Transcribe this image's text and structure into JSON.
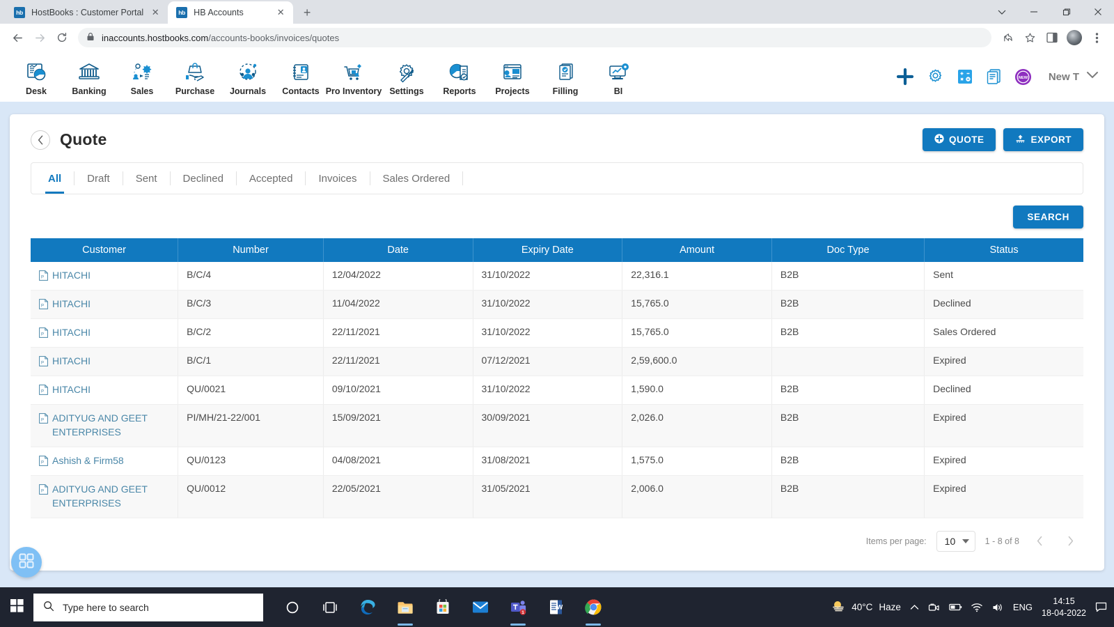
{
  "browser": {
    "tabs": [
      {
        "title": "HostBooks : Customer Portal",
        "favicon": "hb",
        "active": false
      },
      {
        "title": "HB Accounts",
        "favicon": "hb",
        "active": true
      }
    ],
    "new_tab_label": "+",
    "url_domain": "inaccounts.hostbooks.com",
    "url_path": "/accounts-books/invoices/quotes",
    "window_controls": {
      "minimize": "−",
      "maximize": "❐",
      "close": "✕",
      "tab_search": "⌄"
    }
  },
  "appnav": {
    "items": [
      {
        "label": "Desk",
        "icon": "dashboard-icon"
      },
      {
        "label": "Banking",
        "icon": "bank-icon"
      },
      {
        "label": "Sales",
        "icon": "sales-icon"
      },
      {
        "label": "Purchase",
        "icon": "purchase-icon"
      },
      {
        "label": "Journals",
        "icon": "journals-icon"
      },
      {
        "label": "Contacts",
        "icon": "contacts-icon"
      },
      {
        "label": "Pro Inventory",
        "icon": "inventory-icon"
      },
      {
        "label": "Settings",
        "icon": "settings-icon"
      },
      {
        "label": "Reports",
        "icon": "reports-icon"
      },
      {
        "label": "Projects",
        "icon": "projects-icon"
      },
      {
        "label": "Filling",
        "icon": "filling-icon"
      },
      {
        "label": "BI",
        "icon": "bi-icon"
      }
    ],
    "actions": [
      {
        "icon": "plus-icon"
      },
      {
        "icon": "gear-icon"
      },
      {
        "icon": "calculator-icon"
      },
      {
        "icon": "notes-icon"
      },
      {
        "icon": "new-badge-icon",
        "badge_text": "NEW"
      }
    ],
    "user": {
      "name": "New T",
      "chevron": "⌄"
    }
  },
  "page": {
    "title": "Quote",
    "back_icon": "chevron-left-icon",
    "buttons": {
      "quote": "QUOTE",
      "quote_icon": "plus-circle-icon",
      "export": "EXPORT",
      "export_icon": "upload-icon",
      "search": "SEARCH"
    },
    "filter_tabs": [
      {
        "label": "All",
        "active": true
      },
      {
        "label": "Draft",
        "active": false
      },
      {
        "label": "Sent",
        "active": false
      },
      {
        "label": "Declined",
        "active": false
      },
      {
        "label": "Accepted",
        "active": false
      },
      {
        "label": "Invoices",
        "active": false
      },
      {
        "label": "Sales Ordered",
        "active": false
      }
    ],
    "table": {
      "columns": [
        "Customer",
        "Number",
        "Date",
        "Expiry Date",
        "Amount",
        "Doc Type",
        "Status"
      ],
      "rows": [
        {
          "customer": "HITACHI",
          "number": "B/C/4",
          "date": "12/04/2022",
          "expiry": "31/10/2022",
          "amount": "22,316.1",
          "doctype": "B2B",
          "status": "Sent"
        },
        {
          "customer": "HITACHI",
          "number": "B/C/3",
          "date": "11/04/2022",
          "expiry": "31/10/2022",
          "amount": "15,765.0",
          "doctype": "B2B",
          "status": "Declined"
        },
        {
          "customer": "HITACHI",
          "number": "B/C/2",
          "date": "22/11/2021",
          "expiry": "31/10/2022",
          "amount": "15,765.0",
          "doctype": "B2B",
          "status": "Sales Ordered"
        },
        {
          "customer": "HITACHI",
          "number": "B/C/1",
          "date": "22/11/2021",
          "expiry": "07/12/2021",
          "amount": "2,59,600.0",
          "doctype": "",
          "status": "Expired"
        },
        {
          "customer": "HITACHI",
          "number": "QU/0021",
          "date": "09/10/2021",
          "expiry": "31/10/2022",
          "amount": "1,590.0",
          "doctype": "B2B",
          "status": "Declined"
        },
        {
          "customer": "ADITYUG AND GEET ENTERPRISES",
          "number": "PI/MH/21-22/001",
          "date": "15/09/2021",
          "expiry": "30/09/2021",
          "amount": "2,026.0",
          "doctype": "B2B",
          "status": "Expired"
        },
        {
          "customer": "Ashish & Firm58",
          "number": "QU/0123",
          "date": "04/08/2021",
          "expiry": "31/08/2021",
          "amount": "1,575.0",
          "doctype": "B2B",
          "status": "Expired"
        },
        {
          "customer": "ADITYUG AND GEET ENTERPRISES",
          "number": "QU/0012",
          "date": "22/05/2021",
          "expiry": "31/05/2021",
          "amount": "2,006.0",
          "doctype": "B2B",
          "status": "Expired"
        }
      ]
    },
    "pagination": {
      "items_per_page_label": "Items per page:",
      "items_per_page_value": "10",
      "range": "1 - 8 of 8",
      "prev_icon": "chevron-left-icon",
      "next_icon": "chevron-right-icon"
    },
    "fab_icon": "apps-grid-icon"
  },
  "taskbar": {
    "start_icon": "windows-icon",
    "search_placeholder": "Type here to search",
    "search_icon": "search-icon",
    "apps": [
      {
        "icon": "cortana-icon",
        "running": false
      },
      {
        "icon": "task-view-icon",
        "running": false
      },
      {
        "icon": "edge-icon",
        "running": false
      },
      {
        "icon": "file-explorer-icon",
        "running": true
      },
      {
        "icon": "microsoft-store-icon",
        "running": false
      },
      {
        "icon": "mail-icon",
        "running": false
      },
      {
        "icon": "teams-icon",
        "running": true,
        "badge": "1"
      },
      {
        "icon": "word-icon",
        "running": false
      },
      {
        "icon": "chrome-icon",
        "running": true
      }
    ],
    "weather": {
      "temp": "40°C",
      "condition": "Haze",
      "icon": "haze-icon"
    },
    "tray_icons": [
      "chevron-up-icon",
      "meet-now-icon",
      "battery-icon",
      "wifi-icon",
      "volume-icon"
    ],
    "language": "ENG",
    "time": "14:15",
    "date": "18-04-2022",
    "notification_icon": "notification-icon"
  },
  "colors": {
    "brand_blue": "#1179bf",
    "link_blue": "#4a87a8",
    "page_bg": "#d9e7f7",
    "taskbar_bg": "#1f2430"
  }
}
